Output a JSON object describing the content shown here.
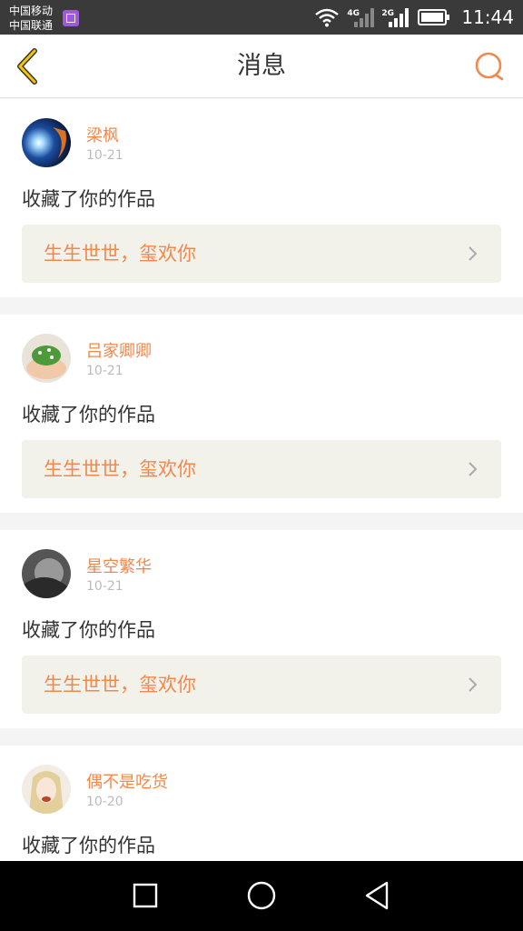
{
  "status_bar": {
    "carrier_1": "中国移动",
    "carrier_2": "中国联通",
    "network_1": "4G",
    "network_2": "2G",
    "time": "11:44"
  },
  "header": {
    "title": "消息",
    "back_icon": "chevron-left-icon",
    "search_icon": "search-icon"
  },
  "colors": {
    "accent": "#f2884b",
    "back_arrow": "#f5c500",
    "card_link_bg": "#f3f2ea"
  },
  "notifications": [
    {
      "user": "梁枫",
      "date": "10-21",
      "action": "收藏了你的作品",
      "work_title": "生生世世，玺欢你"
    },
    {
      "user": "吕家卿卿",
      "date": "10-21",
      "action": "收藏了你的作品",
      "work_title": "生生世世，玺欢你"
    },
    {
      "user": "星空繁华",
      "date": "10-21",
      "action": "收藏了你的作品",
      "work_title": "生生世世，玺欢你"
    },
    {
      "user": "偶不是吃货",
      "date": "10-20",
      "action": "收藏了你的作品",
      "work_title": ""
    }
  ],
  "nav_bar": {
    "icons": [
      "recents-icon",
      "home-icon",
      "back-icon"
    ]
  }
}
